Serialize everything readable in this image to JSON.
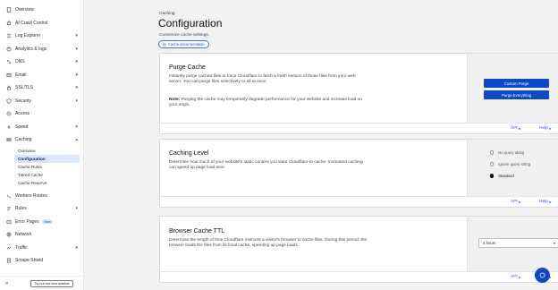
{
  "sidebar": {
    "items": [
      {
        "label": "Overview",
        "icon": "document-icon",
        "chevron": ""
      },
      {
        "label": "AI Crawl Control",
        "icon": "robot-icon",
        "chevron": ""
      },
      {
        "label": "Log Explorer",
        "icon": "log-icon",
        "chevron": "▾"
      },
      {
        "label": "Analytics & logs",
        "icon": "chart-icon",
        "chevron": "▾"
      },
      {
        "label": "DNS",
        "icon": "dns-icon",
        "chevron": "▾"
      },
      {
        "label": "Email",
        "icon": "mail-icon",
        "chevron": "▾"
      },
      {
        "label": "SSL/TLS",
        "icon": "lock-icon",
        "chevron": "▾"
      },
      {
        "label": "Security",
        "icon": "shield-icon",
        "chevron": "▾"
      },
      {
        "label": "Access",
        "icon": "access-icon",
        "chevron": ""
      },
      {
        "label": "Speed",
        "icon": "speed-icon",
        "chevron": "▾"
      },
      {
        "label": "Caching",
        "icon": "caching-icon",
        "chevron": "▴"
      }
    ],
    "caching_sub": [
      "Overview",
      "Configuration",
      "Cache Rules",
      "Tiered Cache",
      "Cache Reserve"
    ],
    "items_after": [
      {
        "label": "Workers Routes",
        "icon": "workers-icon",
        "chevron": ""
      },
      {
        "label": "Rules",
        "icon": "rules-icon",
        "chevron": "▾"
      },
      {
        "label": "Error Pages",
        "icon": "error-icon",
        "chevron": "",
        "badge": "New"
      },
      {
        "label": "Network",
        "icon": "network-icon",
        "chevron": ""
      },
      {
        "label": "Traffic",
        "icon": "traffic-icon",
        "chevron": "▾"
      },
      {
        "label": "Scrape Shield",
        "icon": "scrape-icon",
        "chevron": ""
      }
    ],
    "collapse_icon": "«",
    "try_button": "Try out our new sidebar"
  },
  "header": {
    "breadcrumb": "Caching",
    "title": "Configuration",
    "subtitle": "Customize cache settings.",
    "doc_link": "Cache documentation"
  },
  "purge": {
    "title": "Purge Cache",
    "desc": "Instantly purge cached files to force Cloudflare to fetch a fresh version of those files from your web server. You can purge files selectively or all at once.",
    "note_label": "Note:",
    "note": " Purging the cache may temporarily degrade performance for your website and increase load on your origin.",
    "custom_btn": "Custom Purge",
    "everything_btn": "Purge Everything",
    "api": "API",
    "help": "Help"
  },
  "caching_level": {
    "title": "Caching Level",
    "desc": "Determine how much of your website's static content you want Cloudflare to cache. Increased caching can speed up page load time.",
    "options": [
      "No query string",
      "Ignore query string",
      "Standard"
    ],
    "selected": "Standard",
    "api": "API",
    "help": "Help"
  },
  "browser_ttl": {
    "title": "Browser Cache TTL",
    "desc": "Determine the length of time Cloudflare instructs a visitor's browser to cache files. During this period, the browser loads the files from its local cache, speeding up page loads.",
    "value": "4 hours",
    "api": "API",
    "help": "Help"
  },
  "colors": {
    "accent": "#0a49c9",
    "link": "#1d55cf"
  },
  "chat_icon": "chat-icon"
}
